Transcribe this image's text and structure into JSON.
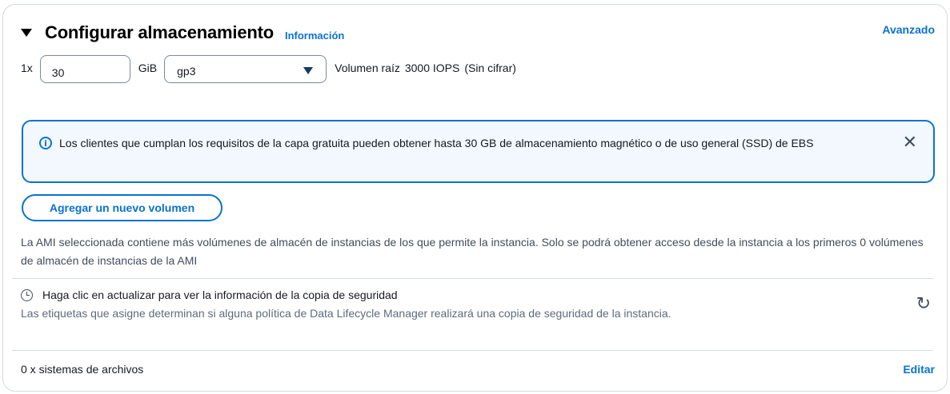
{
  "header": {
    "title": "Configurar almacenamiento",
    "info_link": "Información",
    "advanced_link": "Avanzado"
  },
  "volume": {
    "multiplier": "1x",
    "size_value": "30",
    "size_unit": "GiB",
    "type_selected": "gp3",
    "description": "Volumen raíz",
    "iops": "3000 IOPS",
    "encryption": "(Sin cifrar)"
  },
  "alert": {
    "text": "Los clientes que cumplan los requisitos de la capa gratuita pueden obtener hasta 30 GB de almacenamiento magnético o de uso general (SSD) de EBS",
    "close_glyph": "✕"
  },
  "add_volume_button": "Agregar un nuevo volumen",
  "ami_note": "La AMI seleccionada contiene más volúmenes de almacén de instancias de los que permite la instancia. Solo se podrá obtener acceso desde la instancia a los primeros 0 volúmenes de almacén de instancias de la AMI",
  "backup": {
    "title": "Haga clic en actualizar para ver la información de la copia de seguridad",
    "description": "Las etiquetas que asigne determinan si alguna política de Data Lifecycle Manager realizará una copia de seguridad de la instancia.",
    "refresh_glyph": "↻"
  },
  "file_systems": {
    "label": "0 x sistemas de archivos",
    "edit_link": "Editar"
  },
  "colors": {
    "accent": "#0972d3",
    "alert_background": "#f2f8fd",
    "divider": "#d5dbdb"
  },
  "icons": [
    "caret-down-icon",
    "info-icon",
    "close-icon",
    "clock-icon",
    "refresh-icon",
    "dropdown-caret-icon"
  ]
}
